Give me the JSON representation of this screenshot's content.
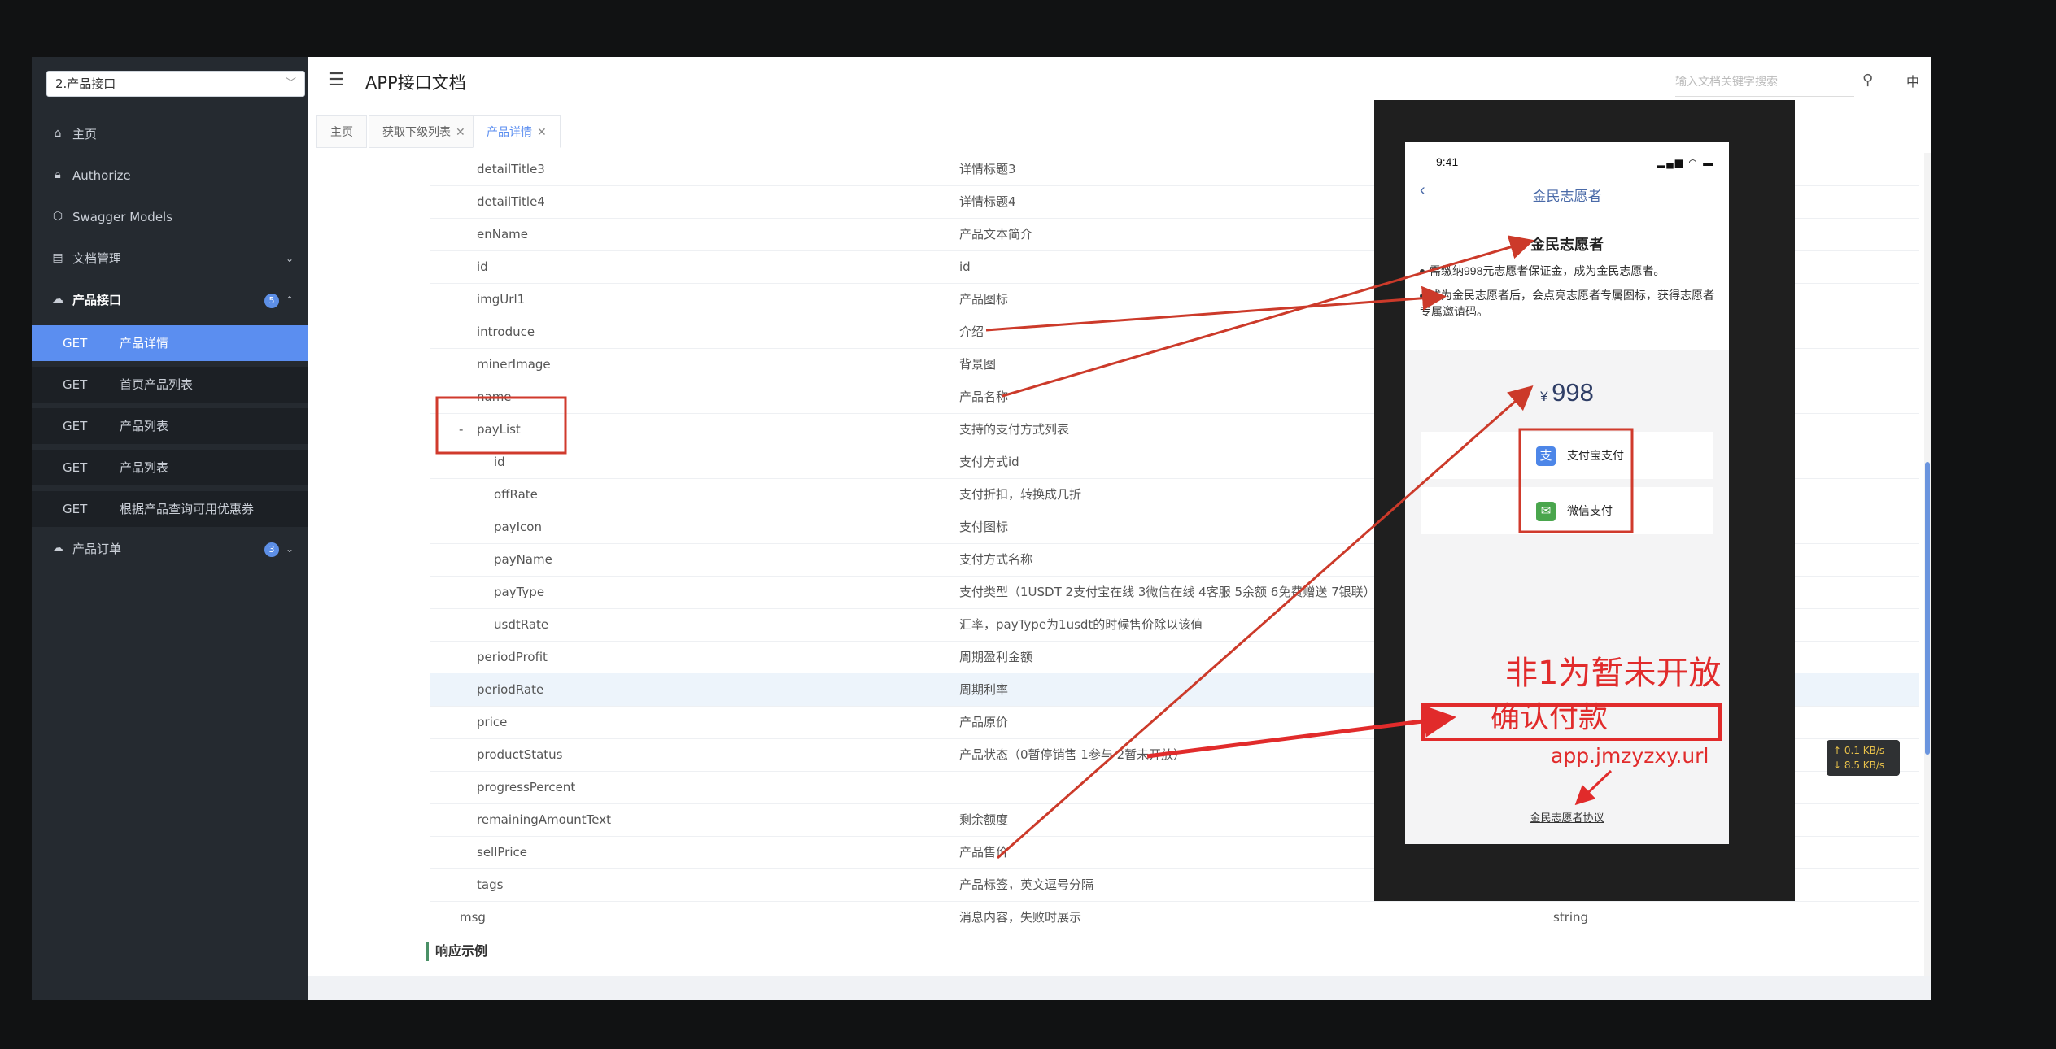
{
  "sidebar": {
    "group_select": "2.产品接口",
    "nav": [
      {
        "label": "主页",
        "icon": "home-icon"
      },
      {
        "label": "Authorize",
        "icon": "lock-icon"
      },
      {
        "label": "Swagger Models",
        "icon": "cube-icon"
      },
      {
        "label": "文档管理",
        "icon": "doc-icon"
      },
      {
        "label": "产品接口",
        "icon": "cloud-icon",
        "badge": "5"
      },
      {
        "label": "产品订单",
        "icon": "cloud-icon",
        "badge": "3"
      }
    ],
    "sub_items": [
      {
        "method": "GET",
        "label": "产品详情",
        "active": true
      },
      {
        "method": "GET",
        "label": "首页产品列表"
      },
      {
        "method": "GET",
        "label": "产品列表"
      },
      {
        "method": "GET",
        "label": "产品列表"
      },
      {
        "method": "GET",
        "label": "根据产品查询可用优惠券"
      }
    ]
  },
  "header": {
    "title": "APP接口文档",
    "search_placeholder": "输入文档关键字搜索",
    "lang": "中"
  },
  "tabs": [
    {
      "label": "主页"
    },
    {
      "label": "获取下级列表",
      "close": "✕"
    },
    {
      "label": "产品详情",
      "close": "✕",
      "active": true
    }
  ],
  "params": [
    {
      "name": "detailTitle3",
      "desc": "详情标题3"
    },
    {
      "name": "detailTitle4",
      "desc": "详情标题4"
    },
    {
      "name": "enName",
      "desc": "产品文本简介"
    },
    {
      "name": "id",
      "desc": "id"
    },
    {
      "name": "imgUrl1",
      "desc": "产品图标"
    },
    {
      "name": "introduce",
      "desc": "介绍"
    },
    {
      "name": "minerImage",
      "desc": "背景图"
    },
    {
      "name": "name",
      "desc": "产品名称"
    },
    {
      "name": "payList",
      "desc": "支持的支付方式列表",
      "toggle": "-"
    },
    {
      "name": "id",
      "desc": "支付方式id",
      "indent": true
    },
    {
      "name": "offRate",
      "desc": "支付折扣，转换成几折",
      "indent": true
    },
    {
      "name": "payIcon",
      "desc": "支付图标",
      "indent": true
    },
    {
      "name": "payName",
      "desc": "支付方式名称",
      "indent": true
    },
    {
      "name": "payType",
      "desc": "支付类型（1USDT 2支付宝在线 3微信在线 4客服 5余额 6免费赠送 7银联）",
      "indent": true
    },
    {
      "name": "usdtRate",
      "desc": "汇率，payType为1usdt的时候售价除以该值",
      "indent": true
    },
    {
      "name": "periodProfit",
      "desc": "周期盈利金额"
    },
    {
      "name": "periodRate",
      "desc": "周期利率",
      "highlight": true
    },
    {
      "name": "price",
      "desc": "产品原价"
    },
    {
      "name": "productStatus",
      "desc": "产品状态（0暂停销售 1参与 2暂未开放）"
    },
    {
      "name": "progressPercent",
      "desc": ""
    },
    {
      "name": "remainingAmountText",
      "desc": "剩余额度"
    },
    {
      "name": "sellPrice",
      "desc": "产品售价"
    },
    {
      "name": "tags",
      "desc": "产品标签，英文逗号分隔"
    },
    {
      "name": "msg",
      "desc": "消息内容，失败时展示",
      "type": "string",
      "top_level": true
    }
  ],
  "response_example_title": "响应示例",
  "phone": {
    "time": "9:41",
    "nav_title": "金民志愿者",
    "heading": "金民志愿者",
    "bullet1": "需缴纳998元志愿者保证金，成为金民志愿者。",
    "bullet2": "成为金民志愿者后，会点亮志愿者专属图标，获得志愿者专属邀请码。",
    "currency": "¥",
    "price": "998",
    "pay_alipay": "支付宝支付",
    "pay_wechat": "微信支付",
    "agreement": "金民志愿者协议"
  },
  "annotations": {
    "not_open": "非1为暂未开放",
    "confirm": "确认付款",
    "url": "app.jmzyzxy.url",
    "color": "#e12b2b"
  },
  "netspeed": {
    "up": "↑ 0.1 KB/s",
    "down": "↓ 8.5 KB/s"
  }
}
